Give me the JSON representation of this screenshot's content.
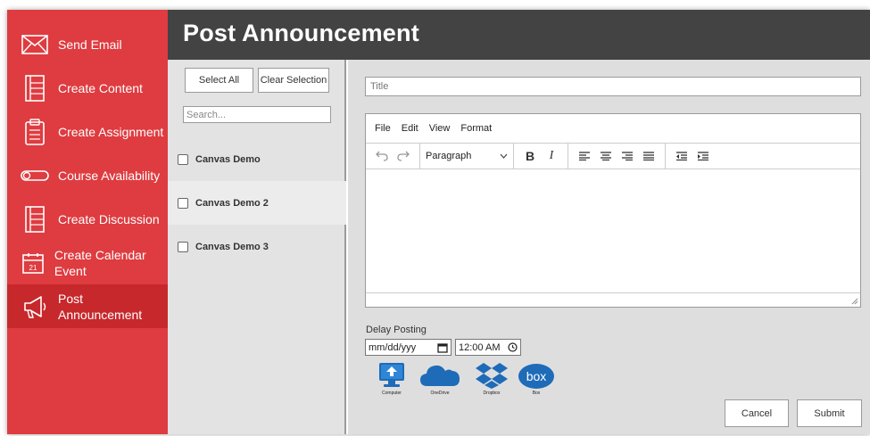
{
  "sidebar": {
    "items": [
      {
        "label": "Send Email",
        "icon": "envelope-icon"
      },
      {
        "label": "Create Content",
        "icon": "document-icon"
      },
      {
        "label": "Create Assignment",
        "icon": "clipboard-icon"
      },
      {
        "label": "Course Availability",
        "icon": "toggle-icon"
      },
      {
        "label": "Create Discussion",
        "icon": "notebook-icon"
      },
      {
        "label": "Create Calendar Event",
        "icon": "calendar-icon",
        "calendar_day": "21"
      },
      {
        "label": "Post Announcement",
        "icon": "megaphone-icon",
        "active": true
      }
    ]
  },
  "header": {
    "title": "Post Announcement"
  },
  "courses": {
    "select_all_label": "Select All",
    "clear_selection_label": "Clear Selection",
    "search_placeholder": "Search...",
    "items": [
      {
        "name": "Canvas Demo",
        "checked": false
      },
      {
        "name": "Canvas Demo 2",
        "checked": false
      },
      {
        "name": "Canvas Demo 3",
        "checked": false
      }
    ]
  },
  "editor": {
    "title_placeholder": "Title",
    "menu": [
      "File",
      "Edit",
      "View",
      "Format"
    ],
    "format_block": "Paragraph",
    "bold_glyph": "B",
    "italic_glyph": "I"
  },
  "delay": {
    "label": "Delay Posting",
    "date_placeholder": "mm/dd/yyy",
    "time_value": "12:00 AM"
  },
  "uploads": [
    {
      "caption": "Computer",
      "icon": "computer-upload-icon"
    },
    {
      "caption": "OneDrive",
      "icon": "onedrive-icon"
    },
    {
      "caption": "Dropbox",
      "icon": "dropbox-icon"
    },
    {
      "caption": "Box",
      "icon": "box-icon",
      "logo_text": "box"
    }
  ],
  "actions": {
    "cancel_label": "Cancel",
    "submit_label": "Submit"
  },
  "colors": {
    "sidebar": "#de3c40",
    "sidebar_active": "#c7282c",
    "header": "#434343",
    "cloud_blue": "#1e6bb8"
  }
}
